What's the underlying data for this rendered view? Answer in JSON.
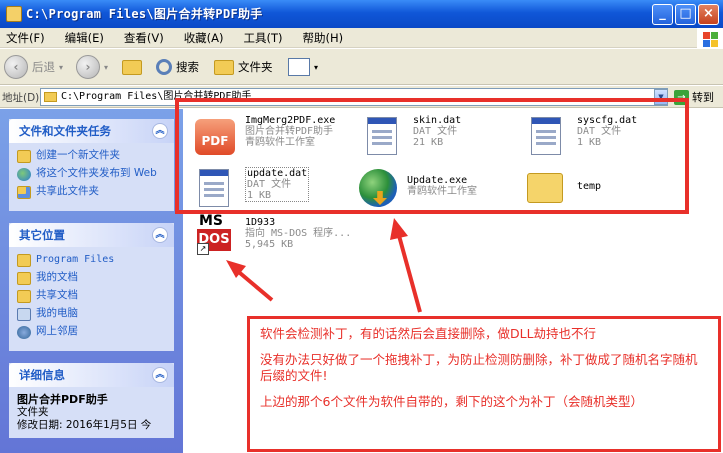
{
  "window": {
    "title": "C:\\Program Files\\图片合并转PDF助手"
  },
  "menu": [
    "文件(F)",
    "编辑(E)",
    "查看(V)",
    "收藏(A)",
    "工具(T)",
    "帮助(H)"
  ],
  "toolbar": {
    "back": "后退",
    "search": "搜索",
    "folders": "文件夹"
  },
  "address": {
    "label": "地址(D)",
    "path": "C:\\Program Files\\图片合并转PDF助手",
    "go": "转到"
  },
  "sidebar": {
    "tasks": {
      "title": "文件和文件夹任务",
      "items": [
        "创建一个新文件夹",
        "将这个文件夹发布到 Web",
        "共享此文件夹"
      ]
    },
    "places": {
      "title": "其它位置",
      "items": [
        "Program Files",
        "我的文档",
        "共享文档",
        "我的电脑",
        "网上邻居"
      ]
    },
    "details": {
      "title": "详细信息",
      "name": "图片合并PDF助手",
      "type": "文件夹",
      "modified": "修改日期: 2016年1月5日 今"
    }
  },
  "files": [
    {
      "name": "ImgMerg2PDF.exe",
      "line2": "图片合并转PDF助手",
      "line3": "青鸥软件工作室",
      "icon": "pdf-app-icon"
    },
    {
      "name": "skin.dat",
      "line2": "DAT 文件",
      "line3": "21 KB",
      "icon": "dat-file-icon"
    },
    {
      "name": "syscfg.dat",
      "line2": "DAT 文件",
      "line3": "1 KB",
      "icon": "dat-file-icon"
    },
    {
      "name": "update.dat",
      "line2": "DAT 文件",
      "line3": "1 KB",
      "icon": "dat-file-icon"
    },
    {
      "name": "Update.exe",
      "line2": "青鸥软件工作室",
      "line3": "",
      "icon": "globe-update-icon"
    },
    {
      "name": "temp",
      "line2": "",
      "line3": "",
      "icon": "folder-icon"
    },
    {
      "name": "1D933",
      "line2": "指向 MS-DOS 程序...",
      "line3": "5,945 KB",
      "icon": "msdos-shortcut-icon"
    }
  ],
  "annotation": {
    "line1": "软件会检测补丁，有的话然后会直接删除，做DLL劫持也不行",
    "line2": "没有办法只好做了一个拖拽补丁，为防止检测防删除，补丁做成了随机名字随机后缀的文件!",
    "line3": "上边的那个6个文件为软件自带的，剩下的这个为补丁（会随机类型）"
  },
  "colors": {
    "annotation_red": "#e8302a",
    "xp_blue": "#0a49c7",
    "task_link": "#215dc6"
  }
}
